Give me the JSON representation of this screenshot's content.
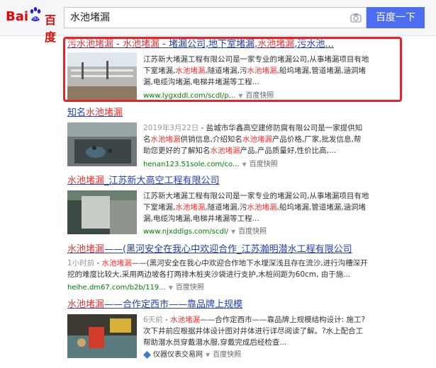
{
  "logo": {
    "bai": "Bai",
    "du": "百度"
  },
  "search": {
    "query": "水池堵漏",
    "button": "百度一下"
  },
  "results": [
    {
      "title_parts": [
        [
          "污水池堵漏",
          true
        ],
        [
          " - ",
          false
        ],
        [
          "水池堵漏",
          true
        ],
        [
          " - 堵漏公司,地下室堵漏,",
          false
        ],
        [
          "水池堵漏",
          true
        ],
        [
          ",污水池...",
          false
        ]
      ],
      "desc_parts": [
        [
          "江苏新大堵漏工程有限公司是一家专业的堵漏公司,从事堵漏项目有地下室堵漏,",
          false
        ],
        [
          "水池堵漏",
          true
        ],
        [
          ",隧道堵漏,污",
          false
        ],
        [
          "水池堵漏",
          true
        ],
        [
          ",船坞堵漏,管道堵漏,涵洞堵漏,电缆沟堵漏,电梯井堵漏等工程...",
          false
        ]
      ],
      "url": "www.lygxddl.com/scdl/p...",
      "snapshot": "百度快照"
    },
    {
      "title_parts": [
        [
          "知名",
          false
        ],
        [
          "水池堵漏",
          true
        ]
      ],
      "date": "2019年3月22日",
      "desc_parts": [
        [
          " - 盐城市华鑫高空建修防腐有限公司是一家提供知名",
          false
        ],
        [
          "水池堵漏",
          true
        ],
        [
          "供销信息,介绍知名",
          false
        ],
        [
          "水池堵漏",
          true
        ],
        [
          "产品价格,厂家,批发信息,帮助您更好的了解知名",
          false
        ],
        [
          "水池堵漏",
          true
        ],
        [
          "产品,产品质量好,性价比高,...",
          false
        ]
      ],
      "url": "henan123.51sole.com/co...",
      "snapshot": "百度快照"
    },
    {
      "title_parts": [
        [
          "水池堵漏",
          true
        ],
        [
          "_江苏新大高空工程有限公司",
          false
        ]
      ],
      "desc_parts": [
        [
          "江苏新大堵漏工程有限公司是一家专业的堵漏公司,从事堵漏项目有地下室堵漏,",
          false
        ],
        [
          "水池堵漏",
          true
        ],
        [
          ",隧道堵漏,污",
          false
        ],
        [
          "水池堵漏",
          true
        ],
        [
          ",船坞堵漏,管道堵漏,涵洞堵漏,电缆沟堵漏,电梯井堵漏等工程...",
          false
        ]
      ],
      "url": "www.njxddlgs.com/scdl/",
      "snapshot": "百度快照"
    },
    {
      "title_parts": [
        [
          "水池堵漏",
          true
        ],
        [
          "——(黑河安全在我心中欢迎合作_江苏瀚明潜水工程有限公司",
          false
        ]
      ],
      "date": "1小时前",
      "desc_parts": [
        [
          " - ",
          false
        ],
        [
          "水池堵漏",
          true
        ],
        [
          "——(黑河安全在我心中欢迎合作地下水埋深浅且存在流沙,进行沟槽深开挖的难度比较大,采用两边坡各打两排木桩夹沙袋进行支护,木桩间距为60cm, 由于施...",
          false
        ]
      ],
      "url": "heihe.dm67.com/b2b/119...",
      "snapshot": "百度快照"
    },
    {
      "title_parts": [
        [
          "水池堵漏",
          true
        ],
        [
          "——合作定西市——靠品牌上规模",
          false
        ]
      ],
      "date": "6天前",
      "desc_parts": [
        [
          " - ",
          false
        ],
        [
          "水池堵漏",
          true
        ],
        [
          "——合作定西市——靠品牌上规模结构设计: 施工?次下井前应根据井体设计图对井体进行详尽阅读了解。?水上配合工帮助潜水员穿戴潜水服,穿戴完成后经检查...",
          false
        ]
      ],
      "url": "仪器仪表交易网",
      "snapshot": "百度快照"
    }
  ],
  "colors": {
    "link": "#2440b3",
    "highlight": "#f73131",
    "url": "#008000",
    "button": "#4e6ef2",
    "frame": "#e3242b"
  }
}
